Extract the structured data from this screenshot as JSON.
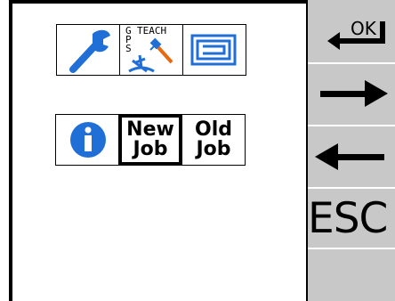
{
  "tiles_row1": {
    "gps_letters": "G\nP\nS",
    "teach_label": "TEACH"
  },
  "tiles_row2": {
    "new_job_line1": "New",
    "new_job_line2": "Job",
    "old_job_line1": "Old",
    "old_job_line2": "Job"
  },
  "sidebar": {
    "ok_label": "OK",
    "esc_label": "ESC"
  },
  "icons": {
    "settings": "wrench-icon",
    "gps_teach": "gps-teach-icon",
    "pattern": "pattern-icon",
    "info": "info-icon",
    "ok": "enter-arrow-icon",
    "next": "right-arrow-icon",
    "back": "left-arrow-icon"
  },
  "colors": {
    "icon_blue": "#1f6fd6",
    "sidebar_gray": "#c8c8c8"
  }
}
